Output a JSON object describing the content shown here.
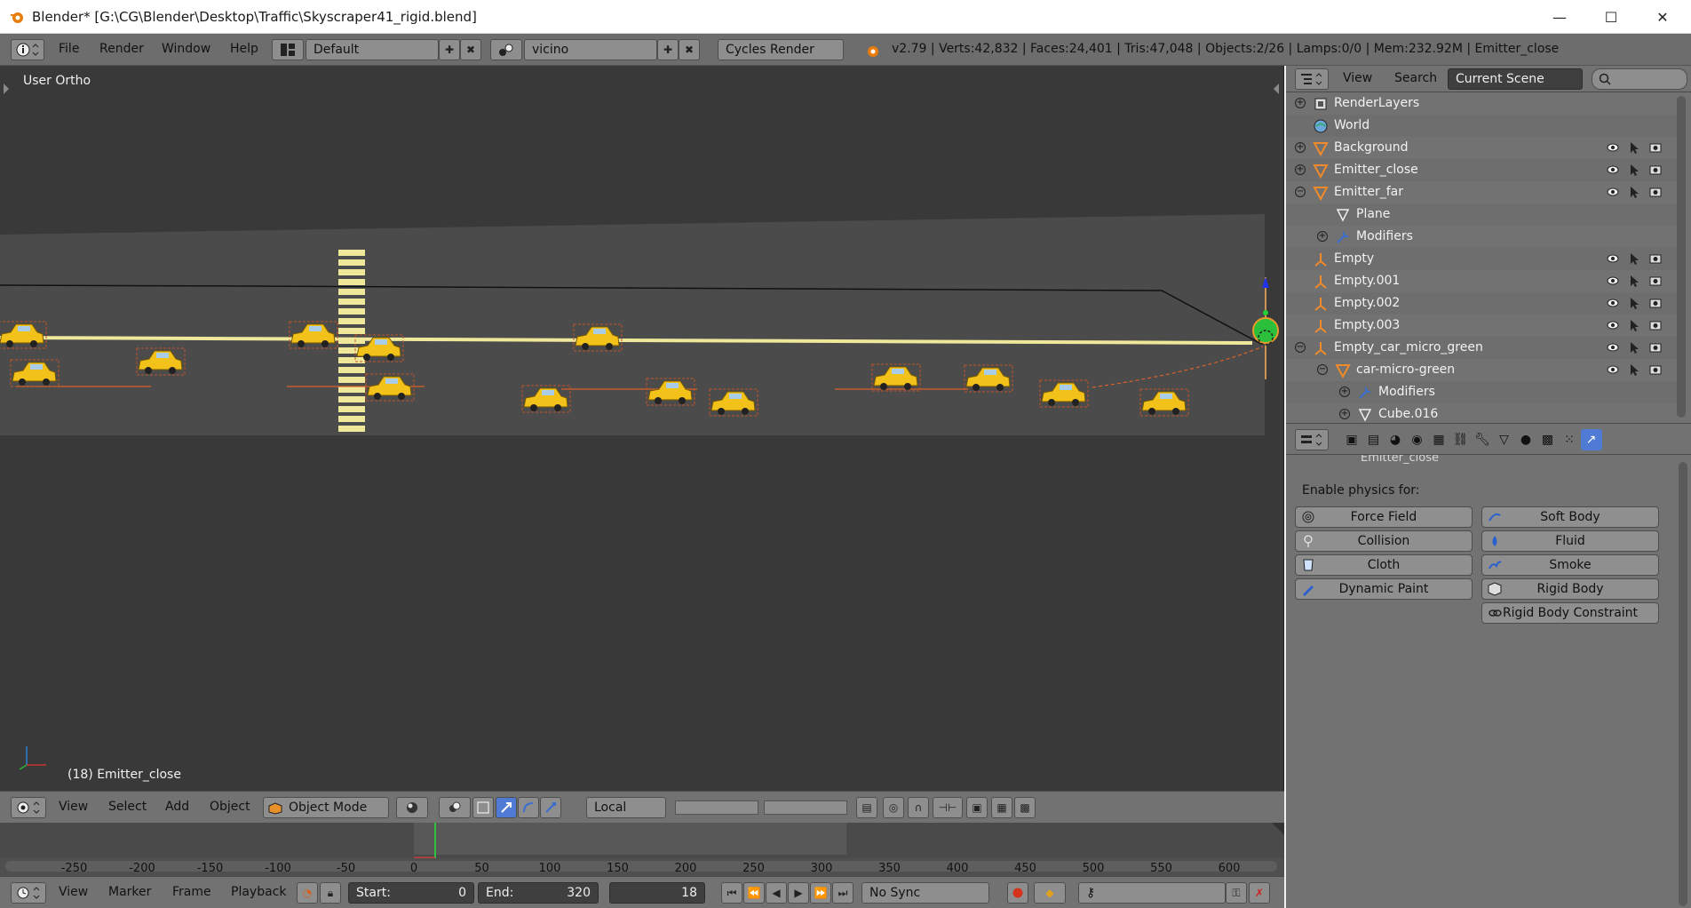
{
  "window": {
    "title": "Blender* [G:\\CG\\Blender\\Desktop\\Traffic\\Skyscraper41_rigid.blend]",
    "minimize_glyph": "—",
    "maximize_glyph": "☐",
    "close_glyph": "✕"
  },
  "info_header": {
    "menus": [
      "File",
      "Render",
      "Window",
      "Help"
    ],
    "screen_layout": "Default",
    "scene": "vicino",
    "render_engine": "Cycles Render",
    "stats": "v2.79 | Verts:42,832 | Faces:24,401 | Tris:47,048 | Objects:2/26 | Lamps:0/0 | Mem:232.92M | Emitter_close"
  },
  "viewport": {
    "view_name": "User Ortho",
    "active_object_label": "(18) Emitter_close"
  },
  "view3d_header": {
    "menus": [
      "View",
      "Select",
      "Add",
      "Object"
    ],
    "mode": "Object Mode",
    "pivot": "Local"
  },
  "timeline": {
    "ruler_labels": [
      "-250",
      "-200",
      "-150",
      "-100",
      "-50",
      "0",
      "50",
      "100",
      "150",
      "200",
      "250",
      "300",
      "350",
      "400",
      "450",
      "500",
      "550",
      "600"
    ],
    "current_frame_marker": 18
  },
  "timeline_header": {
    "menus": [
      "View",
      "Marker",
      "Frame",
      "Playback"
    ],
    "start_label": "Start:",
    "start_value": "0",
    "end_label": "End:",
    "end_value": "320",
    "current_frame": "18",
    "sync": "No Sync"
  },
  "outliner": {
    "header": {
      "menus": [
        "View",
        "Search"
      ],
      "display_mode": "Current Scene"
    },
    "rows": [
      {
        "label": "RenderLayers",
        "icon": "render-layers-icon",
        "indent": 0,
        "expander": "plus",
        "visibility": false
      },
      {
        "label": "World",
        "icon": "world-icon",
        "indent": 0,
        "expander": "none",
        "visibility": false
      },
      {
        "label": "Background",
        "icon": "mesh-object-icon",
        "indent": 0,
        "expander": "plus",
        "visibility": true
      },
      {
        "label": "Emitter_close",
        "icon": "mesh-object-icon",
        "indent": 0,
        "expander": "plus",
        "visibility": true
      },
      {
        "label": "Emitter_far",
        "icon": "mesh-object-icon",
        "indent": 0,
        "expander": "minus",
        "visibility": true
      },
      {
        "label": "Plane",
        "icon": "mesh-data-icon",
        "indent": 1,
        "expander": "none",
        "visibility": false
      },
      {
        "label": "Modifiers",
        "icon": "wrench-icon",
        "indent": 1,
        "expander": "plus",
        "visibility": false
      },
      {
        "label": "Empty",
        "icon": "empty-icon",
        "indent": 0,
        "expander": "none",
        "visibility": true
      },
      {
        "label": "Empty.001",
        "icon": "empty-icon",
        "indent": 0,
        "expander": "none",
        "visibility": true
      },
      {
        "label": "Empty.002",
        "icon": "empty-icon",
        "indent": 0,
        "expander": "none",
        "visibility": true
      },
      {
        "label": "Empty.003",
        "icon": "empty-icon",
        "indent": 0,
        "expander": "none",
        "visibility": true
      },
      {
        "label": "Empty_car_micro_green",
        "icon": "empty-icon",
        "indent": 0,
        "expander": "minus",
        "visibility": true
      },
      {
        "label": "car-micro-green",
        "icon": "mesh-object-icon",
        "indent": 1,
        "expander": "minus",
        "visibility": true
      },
      {
        "label": "Modifiers",
        "icon": "wrench-icon",
        "indent": 2,
        "expander": "plus",
        "visibility": false
      },
      {
        "label": "Cube.016",
        "icon": "mesh-data-icon",
        "indent": 2,
        "expander": "plus",
        "visibility": false
      }
    ]
  },
  "properties": {
    "section_label": "Enable physics for:",
    "buttons_left": [
      "Force Field",
      "Collision",
      "Cloth",
      "Dynamic Paint"
    ],
    "buttons_right": [
      "Soft Body",
      "Fluid",
      "Smoke",
      "Rigid Body",
      "Rigid Body Constraint"
    ],
    "cutoff_text": "Emitter_close"
  },
  "colors": {
    "viewport_bg": "#393939",
    "road": "#4b4b4b",
    "car_yellow": "#f2c21b",
    "line_yellow": "#efe89a",
    "panel_bg": "#727272",
    "active_blue": "#4f7bd4",
    "selection_orange": "#f08a2a"
  }
}
